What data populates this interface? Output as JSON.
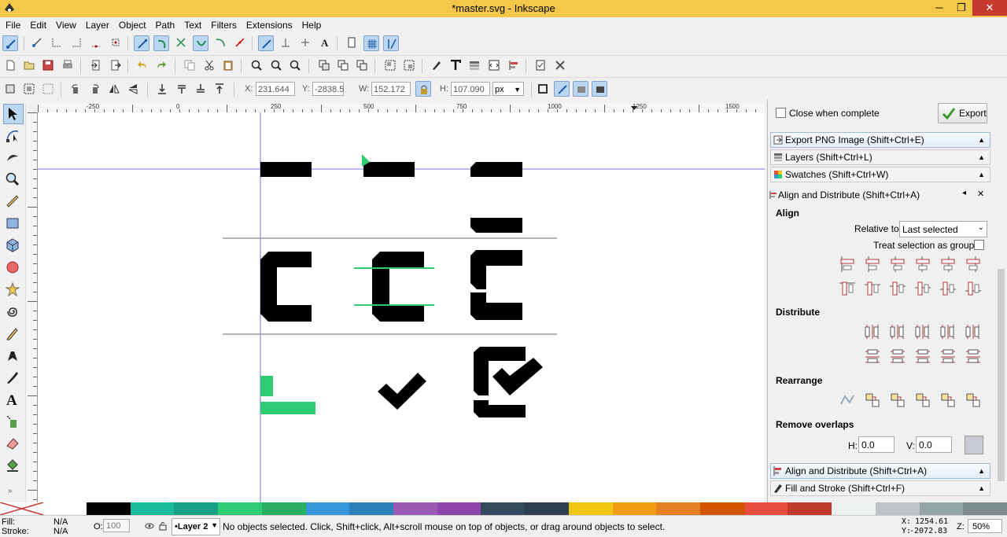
{
  "window": {
    "title": "*master.svg - Inkscape",
    "minimize": "─",
    "maximize": "❐",
    "close": "✕"
  },
  "menu": [
    "File",
    "Edit",
    "View",
    "Layer",
    "Object",
    "Path",
    "Text",
    "Filters",
    "Extensions",
    "Help"
  ],
  "toolcontrols": {
    "x_label": "X:",
    "x_value": "231.644",
    "y_label": "Y:",
    "y_value": "-2838.5",
    "w_label": "W:",
    "w_value": "152.172",
    "h_label": "H:",
    "h_value": "107.090",
    "unit": "px"
  },
  "ruler": {
    "ticks": [
      "-250",
      "0",
      "250",
      "500",
      "750",
      "1000",
      "1250",
      "1500"
    ]
  },
  "export": {
    "close_when_complete": "Close when complete",
    "export_button": "Export"
  },
  "panels": {
    "export_png": "Export PNG Image (Shift+Ctrl+E)",
    "layers": "Layers (Shift+Ctrl+L)",
    "swatches": "Swatches (Shift+Ctrl+W)",
    "align_header": "Align and Distribute (Shift+Ctrl+A)",
    "align_tab": "Align and Distribute (Shift+Ctrl+A)",
    "fill_stroke": "Fill and Stroke (Shift+Ctrl+F)"
  },
  "align": {
    "align_title": "Align",
    "relative_to_label": "Relative to:",
    "relative_to_value": "Last selected",
    "treat_group_label": "Treat selection as group:",
    "distribute_title": "Distribute",
    "rearrange_title": "Rearrange",
    "remove_overlaps_title": "Remove overlaps",
    "h_label": "H:",
    "h_value": "0.0",
    "v_label": "V:",
    "v_value": "0.0"
  },
  "palette_colors": [
    "#000000",
    "#1abc9c",
    "#16a085",
    "#2ecc71",
    "#27ae60",
    "#3498db",
    "#2980b9",
    "#9b59b6",
    "#8e44ad",
    "#34495e",
    "#2c3e50",
    "#f1c40f",
    "#f39c12",
    "#e67e22",
    "#d35400",
    "#e74c3c",
    "#c0392b",
    "#ecf0f1",
    "#bdc3c7",
    "#95a5a6",
    "#7f8c8d"
  ],
  "status": {
    "fill_label": "Fill:",
    "fill_value": "N/A",
    "stroke_label": "Stroke:",
    "stroke_value": "N/A",
    "opacity_label": "O:",
    "opacity_value": "100",
    "layer": "•Layer 2",
    "message": "No objects selected. Click, Shift+click, Alt+scroll mouse on top of objects, or drag around objects to select.",
    "cx_label": "X:",
    "cx_value": "1254.61",
    "cy_label": "Y:",
    "cy_value": "-2072.83",
    "zoom_label": "Z:",
    "zoom_value": "50%"
  },
  "colors": {
    "title_bar": "#f3c74a",
    "guide": "#6b6bd6",
    "accent_green": "#2ecc71",
    "selection_blue": "#bcd6f2"
  }
}
